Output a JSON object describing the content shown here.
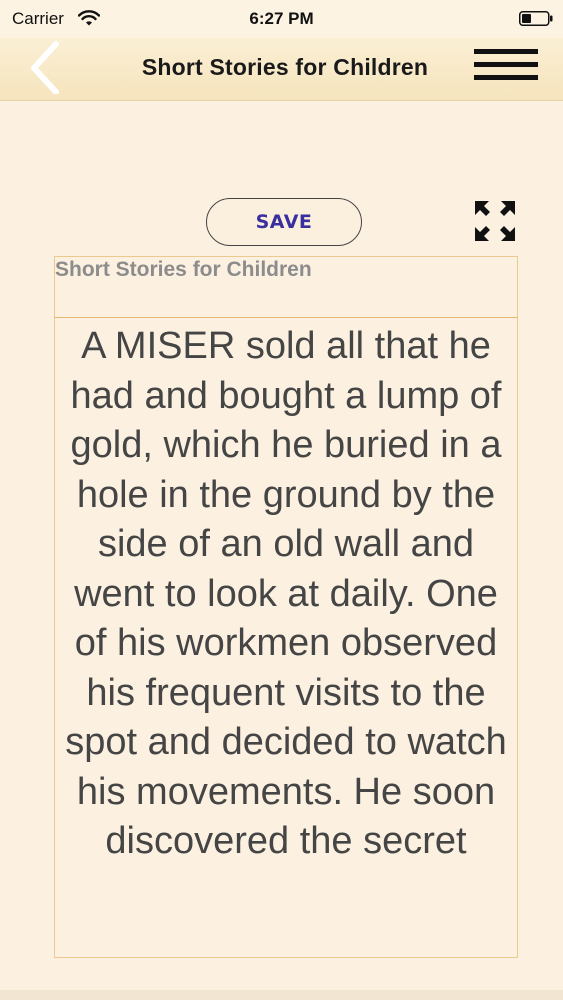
{
  "status_bar": {
    "carrier": "Carrier",
    "time": "6:27 PM"
  },
  "nav": {
    "title": "Short Stories for Children",
    "back_icon": "chevron-left-icon",
    "menu_icon": "hamburger-menu-icon"
  },
  "toolbar": {
    "save_label": "SAVE",
    "expand_icon": "expand-arrows-icon"
  },
  "story": {
    "title": "Short Stories for Children",
    "body": "A MISER sold all that he had and bought a lump of gold, which he buried in a hole in the ground by the side of an old wall and went to look at daily. One of his workmen observed his frequent visits to the spot and decided to watch his movements. He soon discovered the secret"
  },
  "colors": {
    "background": "#fcf1e1",
    "nav_background": "#f5e4bd",
    "save_text": "#3a2f9e",
    "body_text": "#454545",
    "title_text": "#8c8c8c",
    "box_border": "#ecc98f"
  }
}
